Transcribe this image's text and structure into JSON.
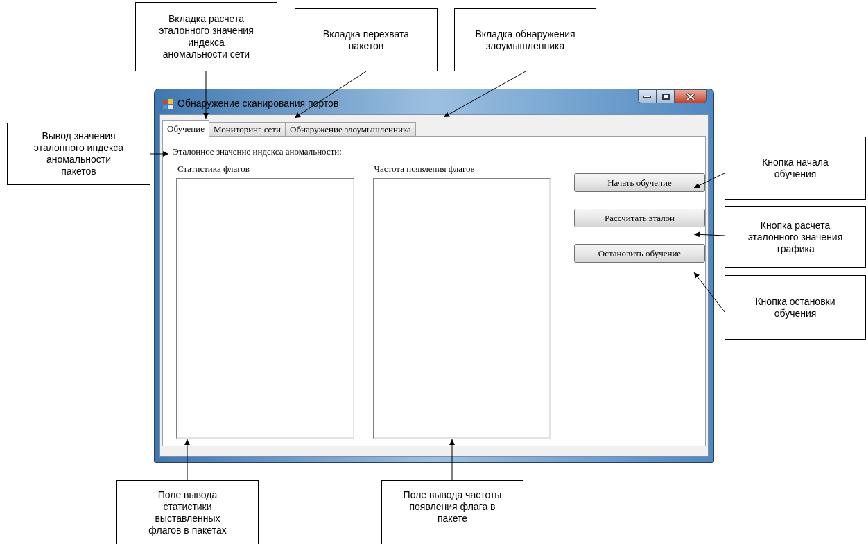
{
  "window": {
    "title": "Обнаружение сканирования портов"
  },
  "tabs": [
    {
      "label": "Обучение",
      "selected": true
    },
    {
      "label": "Мониторинг сети",
      "selected": false
    },
    {
      "label": "Обнаружение злоумышленника",
      "selected": false
    }
  ],
  "reference_label": "Эталонное значение индекса аномальности:",
  "lists": [
    {
      "label": "Статистика флагов"
    },
    {
      "label": "Частота появления флагов"
    }
  ],
  "buttons": [
    "Начать обучение",
    "Рассчитать эталон",
    "Остановить обучение"
  ],
  "callouts": [
    {
      "text": "Вкладка расчета эталонного значения индекса аномальности сети"
    },
    {
      "text": "Вкладка перехвата пакетов"
    },
    {
      "text": "Вкладка обнаружения злоумышленника"
    },
    {
      "text": "Вывод значения эталонного индекса аномальности пакетов"
    },
    {
      "text": "Кнопка начала обучения"
    },
    {
      "text": "Кнопка расчета эталонного значения трафика"
    },
    {
      "text": "Кнопка остановки обучения"
    },
    {
      "text": "Поле вывода статистики выставленных флагов в пакетах"
    },
    {
      "text": "Поле вывода частоты появления флага в пакете"
    }
  ]
}
